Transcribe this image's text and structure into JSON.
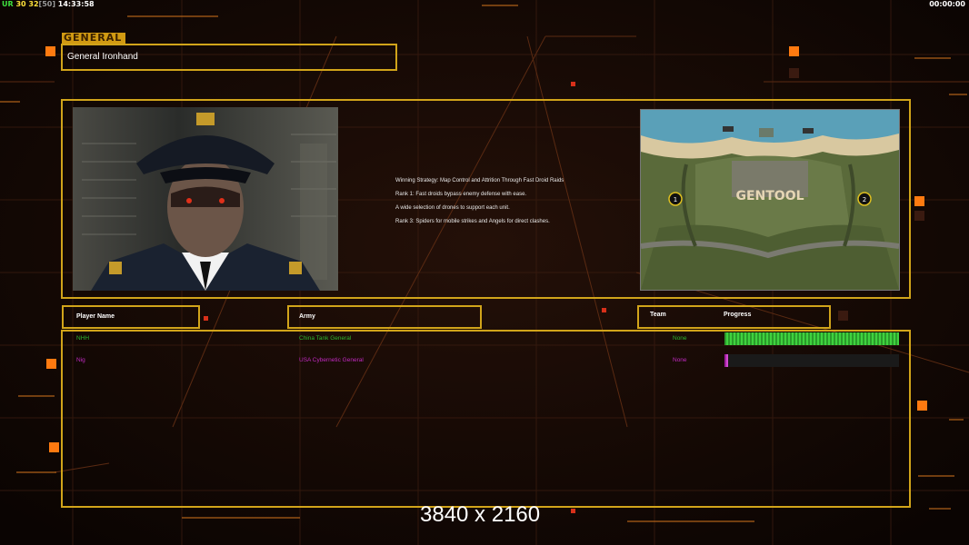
{
  "hud": {
    "ur_label": "UR",
    "stat_a": "30",
    "stat_b": "32",
    "stat_c": "[50]",
    "clock": "14:33:58",
    "timer": "00:00:00"
  },
  "header": {
    "section_title": "GENERAL",
    "general_name": "General Ironhand"
  },
  "strategy": {
    "lines": [
      "Winning Strategy: Map Control and Attrition Through Fast Droid Raids",
      "Rank 1: Fast droids bypass enemy defense with ease.",
      "A wide selection of drones to support each unit.",
      "Rank 3: Spiders for mobile strikes and Angels for direct clashes."
    ]
  },
  "map": {
    "title_text": "GENTOOL",
    "slot_1": "1",
    "slot_2": "2"
  },
  "table": {
    "headers": {
      "player_name": "Player Name",
      "army": "Army",
      "team": "Team",
      "progress": "Progress"
    },
    "rows": [
      {
        "name": "NHH",
        "army": "China Tank General",
        "team": "None",
        "progress": 1.0,
        "color": "#2fb82f"
      },
      {
        "name": "Nig",
        "army": "USA Cybernetic General",
        "team": "None",
        "progress": 0.02,
        "color": "#c02ac0"
      }
    ]
  },
  "footer": {
    "resolution": "3840 x 2160"
  },
  "colors": {
    "accent_gold": "#d1a41a",
    "accent_orange": "#ff7a10",
    "player1": "#2fb82f",
    "player2": "#c02ac0"
  }
}
